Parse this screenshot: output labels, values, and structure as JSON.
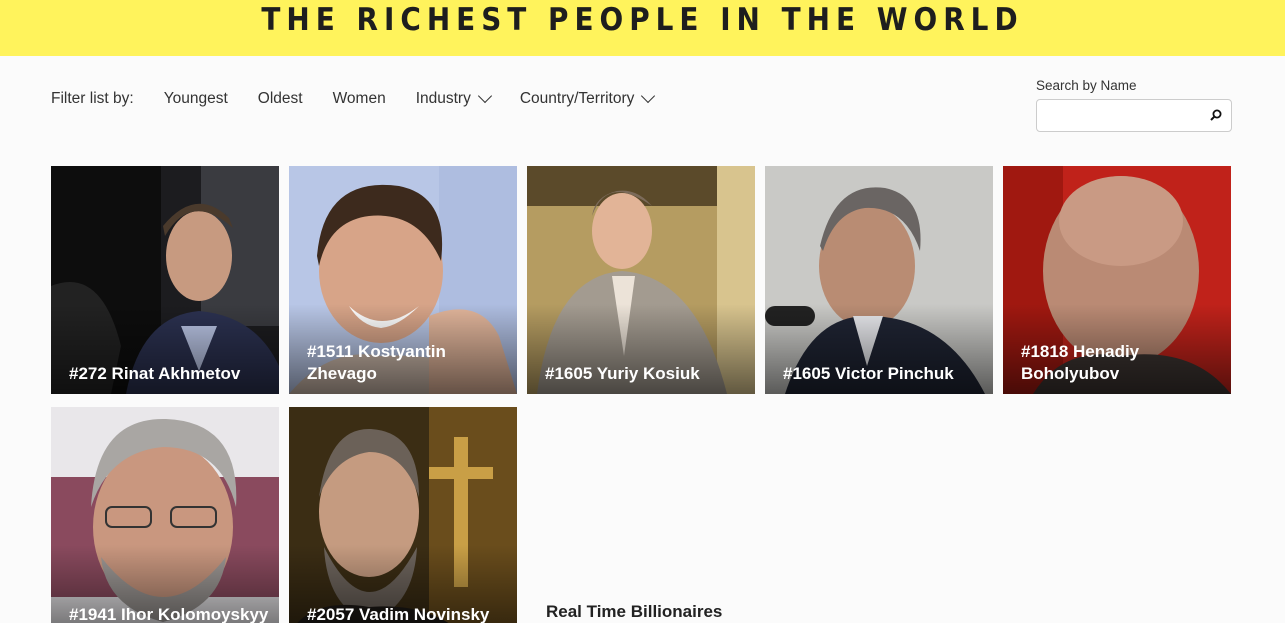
{
  "header": {
    "title": "THE RICHEST PEOPLE IN THE WORLD"
  },
  "filters": {
    "label": "Filter list by:",
    "options": [
      "Youngest",
      "Oldest",
      "Women",
      "Industry",
      "Country/Territory"
    ]
  },
  "search": {
    "label": "Search by Name",
    "value": "",
    "placeholder": ""
  },
  "people": [
    {
      "name": "#272 Rinat Akhmetov"
    },
    {
      "name": "#1511 Kostyantin Zhevago"
    },
    {
      "name": "#1605 Yuriy Kosiuk"
    },
    {
      "name": "#1605 Victor Pinchuk"
    },
    {
      "name": "#1818 Henadiy Boholyubov"
    },
    {
      "name": "#1941 Ihor Kolomoyskyy"
    },
    {
      "name": "#2057 Vadim Novinsky"
    }
  ],
  "section": {
    "title": "Real Time Billionaires"
  }
}
